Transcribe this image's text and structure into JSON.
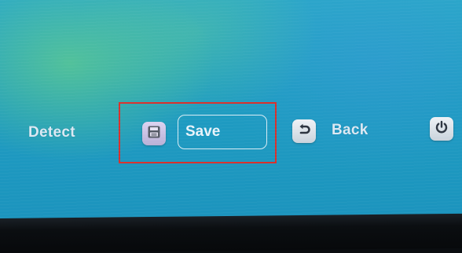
{
  "menu": {
    "detect_label": "Detect",
    "save_label": "Save",
    "back_label": "Back"
  },
  "icons": {
    "save": "floppy-disk-icon",
    "back": "undo-arrow-icon",
    "power": "power-icon"
  },
  "colors": {
    "screen_background": "#1f9cc2",
    "highlight_outline": "#d9302c",
    "label_text": "#dbe9f4"
  }
}
